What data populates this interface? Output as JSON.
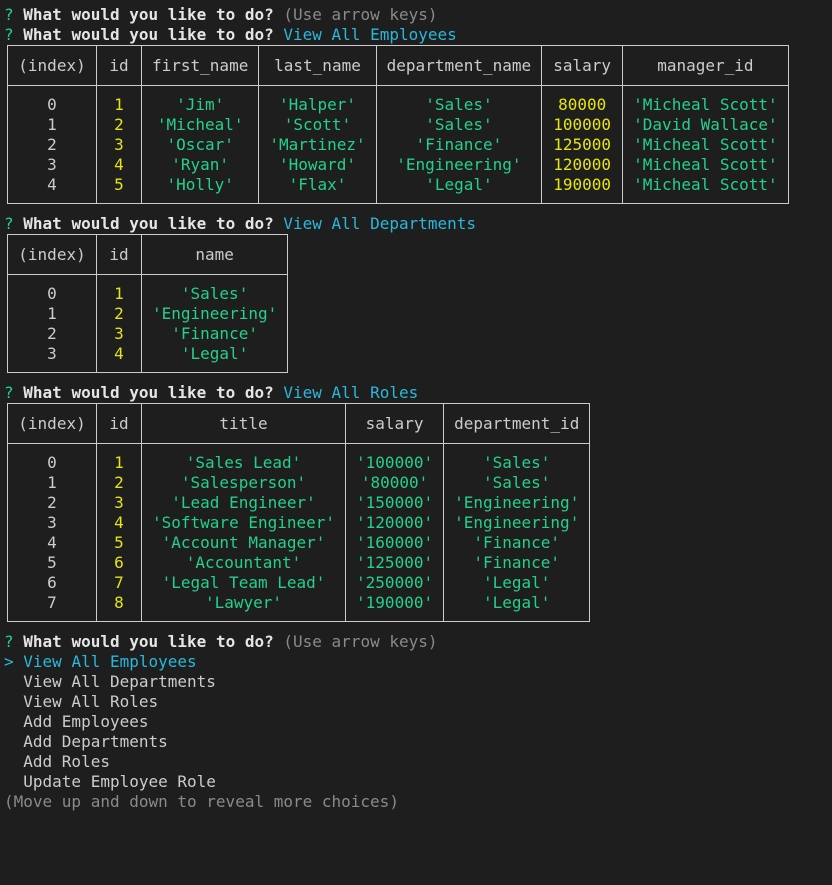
{
  "prompts": {
    "q": "?",
    "question": "What would you like to do?",
    "hint": "(Use arrow keys)",
    "answer_employees": "View All Employees",
    "answer_departments": "View All Departments",
    "answer_roles": "View All Roles"
  },
  "employees": {
    "headers": [
      "(index)",
      "id",
      "first_name",
      "last_name",
      "department_name",
      "salary",
      "manager_id"
    ],
    "rows": [
      [
        "0",
        "1",
        "'Jim'",
        "'Halper'",
        "'Sales'",
        "80000",
        "'Micheal Scott'"
      ],
      [
        "1",
        "2",
        "'Micheal'",
        "'Scott'",
        "'Sales'",
        "100000",
        "'David Wallace'"
      ],
      [
        "2",
        "3",
        "'Oscar'",
        "'Martinez'",
        "'Finance'",
        "125000",
        "'Micheal Scott'"
      ],
      [
        "3",
        "4",
        "'Ryan'",
        "'Howard'",
        "'Engineering'",
        "120000",
        "'Micheal Scott'"
      ],
      [
        "4",
        "5",
        "'Holly'",
        "'Flax'",
        "'Legal'",
        "190000",
        "'Micheal Scott'"
      ]
    ]
  },
  "departments": {
    "headers": [
      "(index)",
      "id",
      "name"
    ],
    "rows": [
      [
        "0",
        "1",
        "'Sales'"
      ],
      [
        "1",
        "2",
        "'Engineering'"
      ],
      [
        "2",
        "3",
        "'Finance'"
      ],
      [
        "3",
        "4",
        "'Legal'"
      ]
    ]
  },
  "roles": {
    "headers": [
      "(index)",
      "id",
      "title",
      "salary",
      "department_id"
    ],
    "rows": [
      [
        "0",
        "1",
        "'Sales Lead'",
        "'100000'",
        "'Sales'"
      ],
      [
        "1",
        "2",
        "'Salesperson'",
        "'80000'",
        "'Sales'"
      ],
      [
        "2",
        "3",
        "'Lead Engineer'",
        "'150000'",
        "'Engineering'"
      ],
      [
        "3",
        "4",
        "'Software Engineer'",
        "'120000'",
        "'Engineering'"
      ],
      [
        "4",
        "5",
        "'Account Manager'",
        "'160000'",
        "'Finance'"
      ],
      [
        "5",
        "6",
        "'Accountant'",
        "'125000'",
        "'Finance'"
      ],
      [
        "6",
        "7",
        "'Legal Team Lead'",
        "'250000'",
        "'Legal'"
      ],
      [
        "7",
        "8",
        "'Lawyer'",
        "'190000'",
        "'Legal'"
      ]
    ]
  },
  "menu": {
    "pointer": ">",
    "options": [
      "View All Employees",
      "View All Departments",
      "View All Roles",
      "Add Employees",
      "Add Departments",
      "Add Roles",
      "Update Employee Role"
    ],
    "footer": "(Move up and down to reveal more choices)"
  },
  "colors": {
    "background": "#1e1e1e",
    "green": "#23d18b",
    "yellow": "#e5e510",
    "cyan": "#29b8db",
    "gray": "#8a8a8a"
  }
}
